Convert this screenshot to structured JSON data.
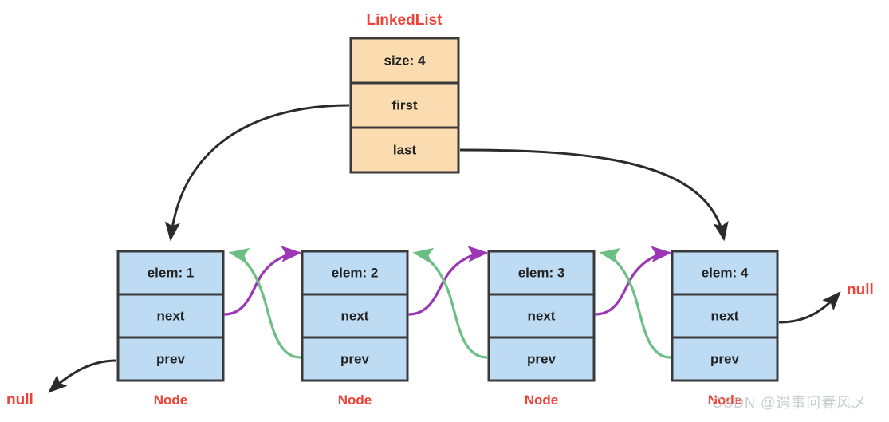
{
  "diagram": {
    "title": "LinkedList",
    "title_color": "#ef4136",
    "colors": {
      "list_box_fill": "#fbdcb0",
      "node_box_fill": "#bddcf4",
      "box_stroke": "#3a3a3a",
      "next_arrow": "#9c36b5",
      "prev_arrow": "#6cbf84",
      "pointer_arrow": "#2b2b2b",
      "accent_red": "#ef4136"
    },
    "list_box": {
      "name": "LinkedList",
      "fields": [
        {
          "label": "size: 4"
        },
        {
          "label": "first"
        },
        {
          "label": "last"
        }
      ]
    },
    "nodes": [
      {
        "caption": "Node",
        "elem": "elem: 1",
        "next": "next",
        "prev": "prev"
      },
      {
        "caption": "Node",
        "elem": "elem: 2",
        "next": "next",
        "prev": "prev"
      },
      {
        "caption": "Node",
        "elem": "elem: 3",
        "next": "next",
        "prev": "prev"
      },
      {
        "caption": "Node",
        "elem": "elem: 4",
        "next": "next",
        "prev": "prev"
      }
    ],
    "null_left": "null",
    "null_right": "null"
  },
  "watermark": {
    "text": "CSDN @遇事问春风乄"
  }
}
